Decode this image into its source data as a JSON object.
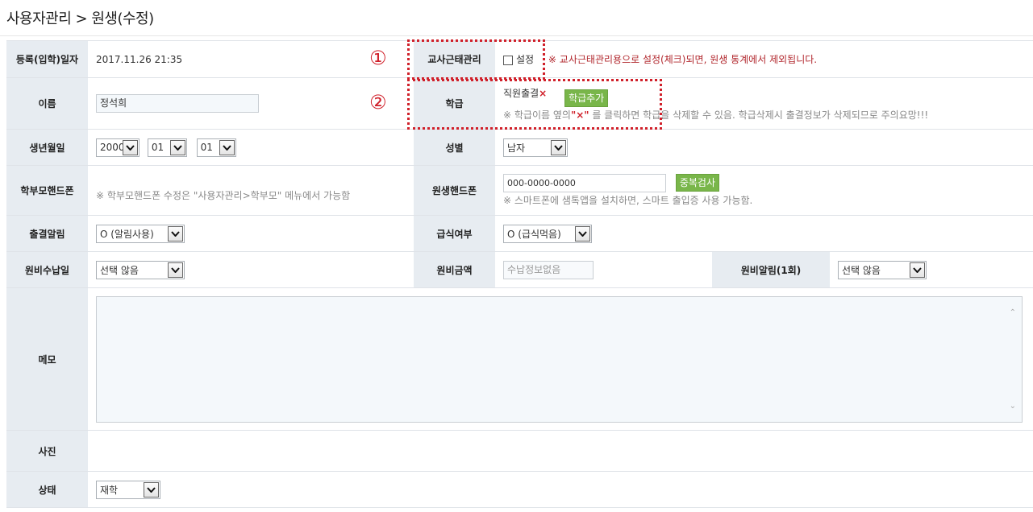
{
  "page": {
    "title": "사용자관리 > 원생(수정)"
  },
  "annotations": {
    "circle1": "①",
    "circle2": "②"
  },
  "form": {
    "reg_date": {
      "label": "등록(입학)일자",
      "value": "2017.11.26 21:35"
    },
    "teacher_attendance": {
      "label": "교사근태관리",
      "checkbox_label": "설정",
      "checked": false,
      "warning": "※ 교사근태관리용으로 설정(체크)되면, 원생 통계에서 제외됩니다."
    },
    "name": {
      "label": "이름",
      "value": "정석희"
    },
    "class": {
      "label": "학급",
      "value": "직원출결",
      "remove_mark": "×",
      "add_button": "학급추가",
      "note_part1": "※ 학급이름 옆의",
      "note_x": "\"×\"",
      "note_part2": "를 클릭하면 학급을 삭제할 수 있음. 학급삭제시 출결정보가 삭제되므로 주의요망!!!"
    },
    "birth": {
      "label": "생년월일",
      "year": "2000",
      "month": "01",
      "day": "01"
    },
    "gender": {
      "label": "성별",
      "value": "남자"
    },
    "parent_phone": {
      "label": "학부모핸드폰",
      "note": "※ 학부모핸드폰 수정은 \"사용자관리>학부모\" 메뉴에서 가능함"
    },
    "student_phone": {
      "label": "원생핸드폰",
      "value": "000-0000-0000",
      "dup_button": "중복검사",
      "note": "※ 스마트폰에 샘톡앱을 설치하면, 스마트 출입증 사용 가능함."
    },
    "attendance_alert": {
      "label": "출결알림",
      "value": "O (알림사용)"
    },
    "meal": {
      "label": "급식여부",
      "value": "O (급식먹음)"
    },
    "fee_day": {
      "label": "원비수납일",
      "value": "선택 않음"
    },
    "fee_amount": {
      "label": "원비금액",
      "placeholder": "수납정보없음"
    },
    "fee_alert": {
      "label": "원비알림(1회)",
      "value": "선택 않음"
    },
    "memo": {
      "label": "메모",
      "value": ""
    },
    "photo": {
      "label": "사진"
    },
    "status": {
      "label": "상태",
      "value": "재학"
    }
  }
}
